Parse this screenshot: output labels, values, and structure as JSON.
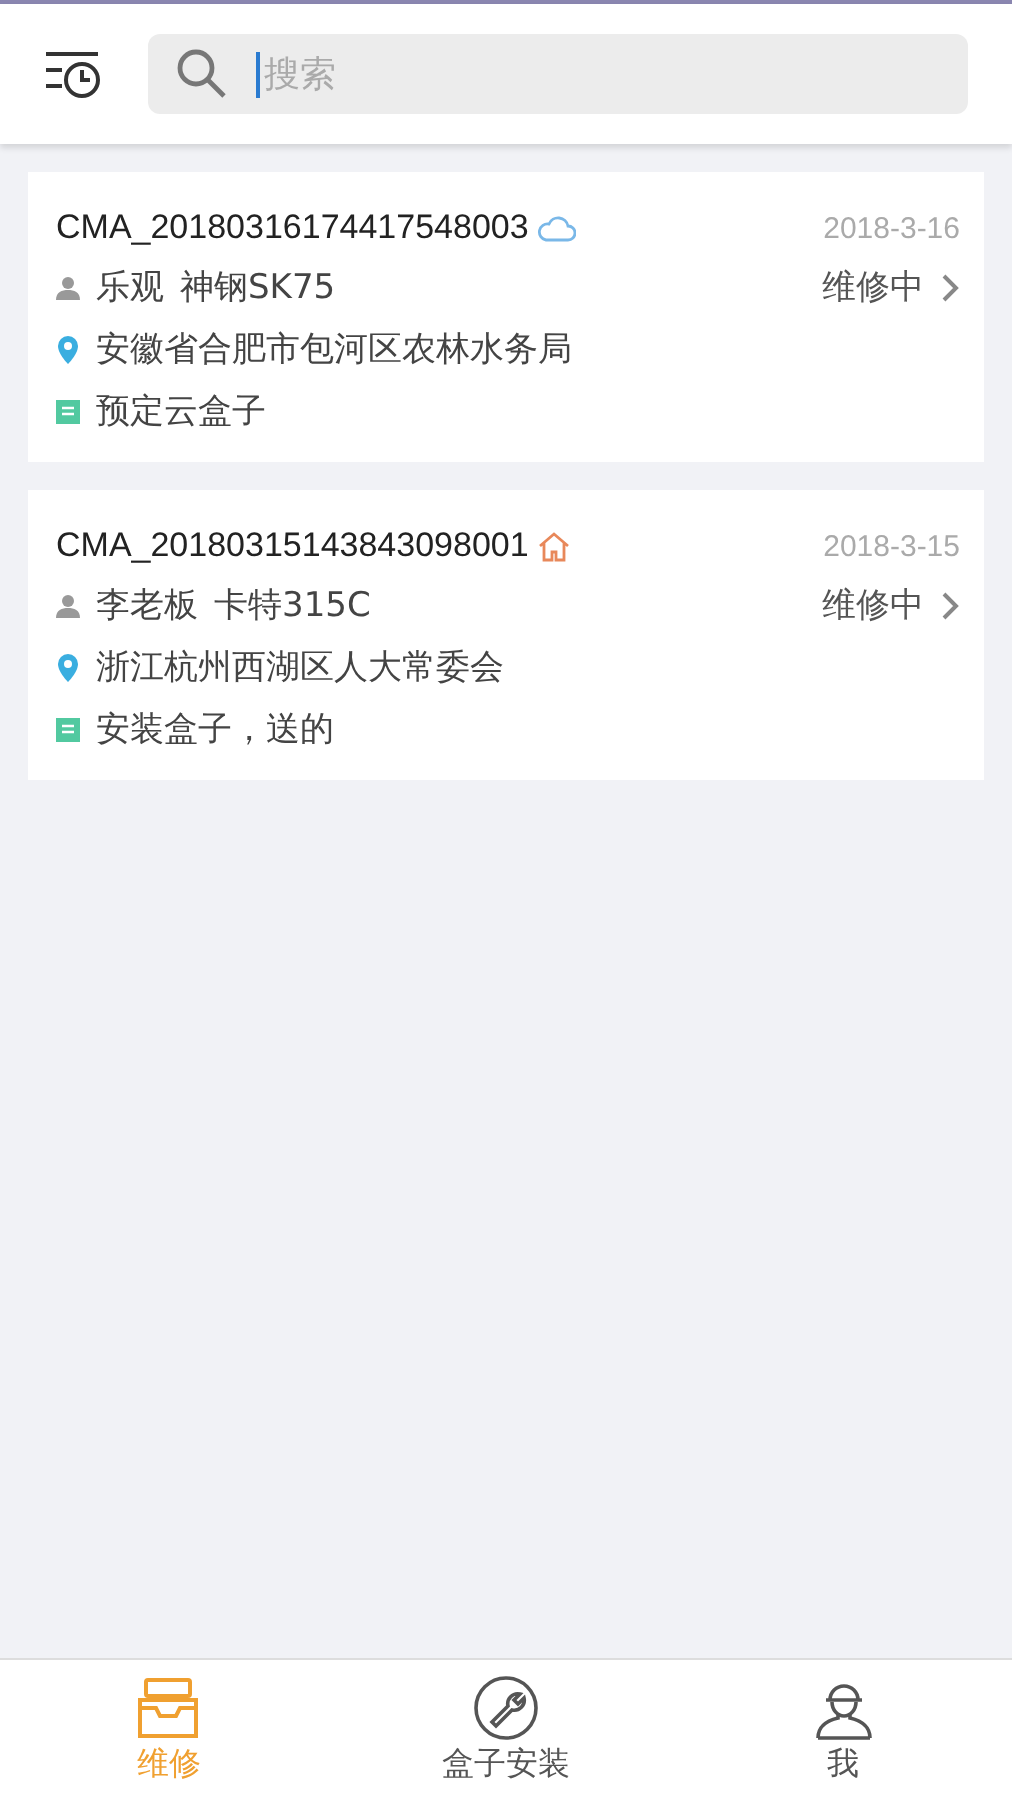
{
  "search": {
    "placeholder": "搜索"
  },
  "orders": [
    {
      "code": "CMA_20180316174417548003",
      "kind": "cloud",
      "date": "2018-3-16",
      "owner": "乐观",
      "machine": "神钢SK75",
      "status": "维修中",
      "address": "安徽省合肥市包河区农林水务局",
      "note": "预定云盒子"
    },
    {
      "code": "CMA_20180315143843098001",
      "kind": "home",
      "date": "2018-3-15",
      "owner": "李老板",
      "machine": "卡特315C",
      "status": "维修中",
      "address": "浙江杭州西湖区人大常委会",
      "note": "安装盒子，送的"
    }
  ],
  "tabs": [
    {
      "label": "维修",
      "kind": "tray",
      "selected": true
    },
    {
      "label": "盒子安装",
      "kind": "wrench",
      "selected": false
    },
    {
      "label": "我",
      "kind": "worker",
      "selected": false
    }
  ]
}
